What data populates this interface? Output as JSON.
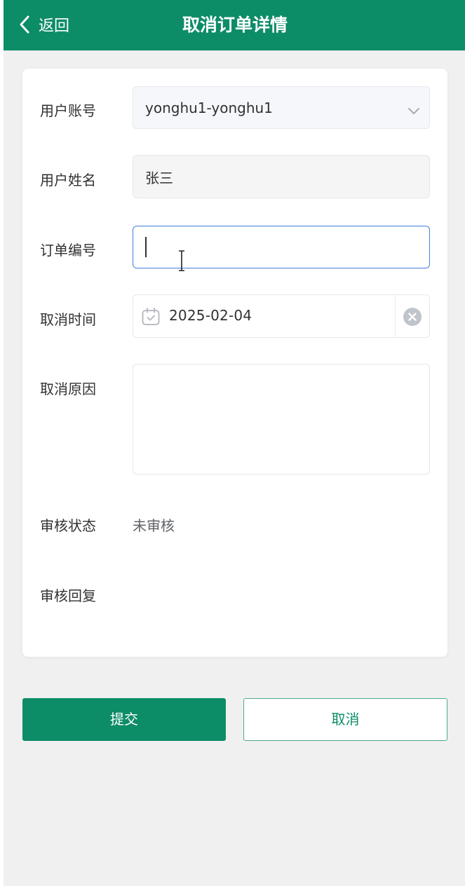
{
  "header": {
    "back_label": "返回",
    "title": "取消订单详情"
  },
  "form": {
    "user_account": {
      "label": "用户账号",
      "value": "yonghu1-yonghu1",
      "icon": "chevron-down-icon"
    },
    "user_name": {
      "label": "用户姓名",
      "value": "张三"
    },
    "order_number": {
      "label": "订单编号",
      "value": ""
    },
    "cancel_time": {
      "label": "取消时间",
      "value": "2025-02-04",
      "icon": "calendar-icon",
      "clear_icon": "clear-icon"
    },
    "cancel_reason": {
      "label": "取消原因",
      "value": ""
    },
    "review_status": {
      "label": "审核状态",
      "value": "未审核"
    },
    "review_reply": {
      "label": "审核回复",
      "value": ""
    }
  },
  "actions": {
    "submit_label": "提交",
    "cancel_label": "取消"
  },
  "colors": {
    "primary": "#0d8c68",
    "focus_border": "#3e7ee0",
    "page_background": "#f0f0f0"
  }
}
